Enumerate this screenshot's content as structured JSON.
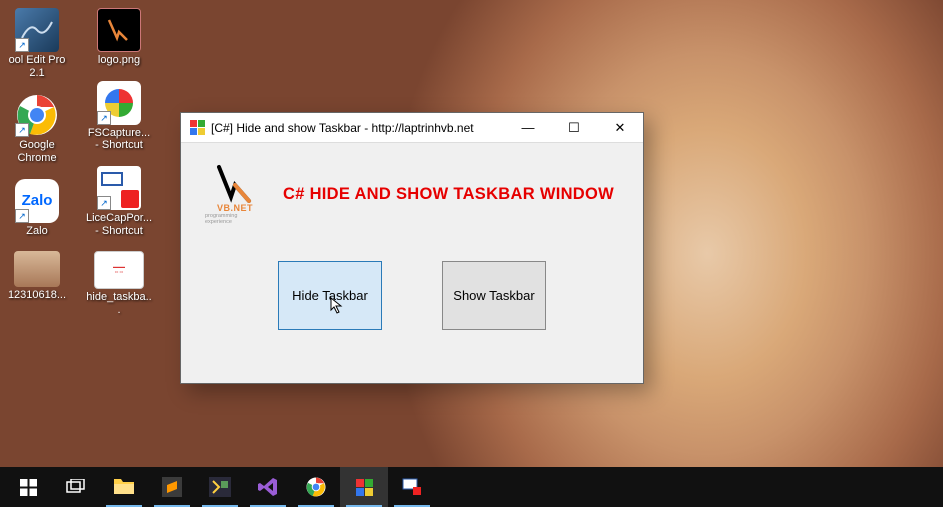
{
  "desktop": {
    "col1": [
      {
        "label": "ool Edit Pro 2.1"
      },
      {
        "label": "Google Chrome"
      },
      {
        "label": "Zalo"
      },
      {
        "label": "12310618..."
      }
    ],
    "col2": [
      {
        "label": "logo.png"
      },
      {
        "label": "FSCapture... - Shortcut"
      },
      {
        "label": "LiceCapPor... - Shortcut"
      },
      {
        "label": "hide_taskba..."
      }
    ]
  },
  "window": {
    "title": "[C#] Hide and show Taskbar - http://laptrinhvb.net",
    "logo_main": "VB.NET",
    "logo_sub": "programming experience",
    "heading": "C# HIDE AND SHOW TASKBAR WINDOW",
    "btn_hide": "Hide Taskbar",
    "btn_show": "Show Taskbar",
    "minimize": "—",
    "maximize": "☐",
    "close": "✕"
  },
  "taskbar": {
    "items": [
      "start",
      "taskview",
      "explorer",
      "sublime",
      "vstools",
      "vs",
      "chrome",
      "app",
      "licecap"
    ]
  }
}
